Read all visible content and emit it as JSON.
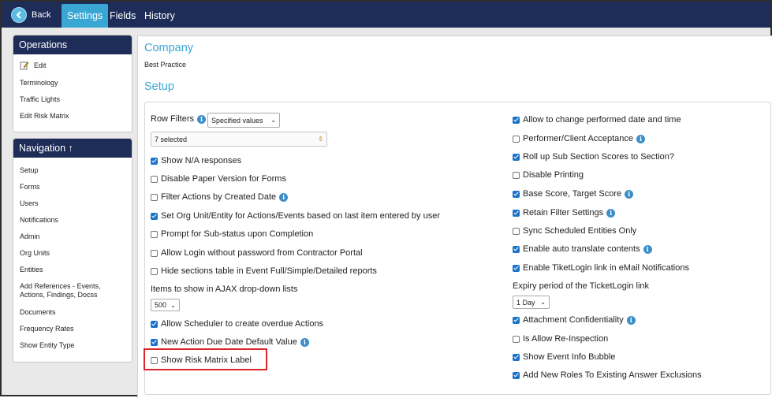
{
  "topbar": {
    "back_label": "Back",
    "tabs": [
      {
        "label": "Settings",
        "active": true
      },
      {
        "label": "Fields",
        "active": false
      },
      {
        "label": "History",
        "active": false
      }
    ]
  },
  "sidebar": {
    "operations": {
      "title": "Operations",
      "items": [
        "Edit",
        "Terminology",
        "Traffic Lights",
        "Edit Risk Matrix"
      ]
    },
    "navigation": {
      "title": "Navigation ↑",
      "items": [
        "Setup",
        "Forms",
        "Users",
        "Notifications",
        "Admin",
        "Org Units",
        "Entities",
        "Add References - Events, Actions, Findings, Docss",
        "Documents",
        "Frequency Rates",
        "Show Entity Type"
      ]
    }
  },
  "main": {
    "company_title": "Company",
    "company_value": "Best Practice",
    "setup_title": "Setup",
    "row_filters_label": "Row Filters",
    "row_filters_select": "Specified values",
    "row_filters_multi": "7 selected",
    "items_ajax_label": "Items to show in AJAX drop-down lists",
    "items_ajax_value": "500",
    "expiry_label": "Expiry period of the TicketLogin link",
    "expiry_value": "1 Day",
    "left_options": [
      {
        "label": "Show N/A responses",
        "checked": true,
        "info": false
      },
      {
        "label": "Disable Paper Version for Forms",
        "checked": false,
        "info": false
      },
      {
        "label": "Filter Actions by Created Date",
        "checked": false,
        "info": true
      },
      {
        "label": "Set Org Unit/Entity for Actions/Events based on last item entered by user",
        "checked": true,
        "info": false
      },
      {
        "label": "Prompt for Sub-status upon Completion",
        "checked": false,
        "info": false
      },
      {
        "label": "Allow Login without password from Contractor Portal",
        "checked": false,
        "info": false
      },
      {
        "label": "Hide sections table in Event Full/Simple/Detailed  reports",
        "checked": false,
        "info": false
      }
    ],
    "left_options_bottom": [
      {
        "label": "Allow Scheduler to create overdue Actions",
        "checked": true,
        "info": false
      },
      {
        "label": "New Action Due Date Default Value",
        "checked": true,
        "info": true
      },
      {
        "label": "Show Risk Matrix Label",
        "checked": false,
        "info": false
      }
    ],
    "right_options": [
      {
        "label": "Allow to change performed date and time",
        "checked": true,
        "info": false
      },
      {
        "label": "Performer/Client Acceptance",
        "checked": false,
        "info": true
      },
      {
        "label": "Roll up Sub Section Scores to Section?",
        "checked": true,
        "info": false
      },
      {
        "label": "Disable Printing",
        "checked": false,
        "info": false
      },
      {
        "label": "Base Score, Target Score",
        "checked": true,
        "info": true
      },
      {
        "label": "Retain Filter Settings",
        "checked": true,
        "info": true
      },
      {
        "label": "Sync Scheduled Entities Only",
        "checked": false,
        "info": false
      },
      {
        "label": "Enable auto translate contents",
        "checked": true,
        "info": true
      },
      {
        "label": "Enable TiketLogin link in eMail Notifications",
        "checked": true,
        "info": false
      }
    ],
    "right_options_bottom": [
      {
        "label": "Attachment Confidentiality",
        "checked": true,
        "info": true
      },
      {
        "label": "Is Allow Re-Inspection",
        "checked": false,
        "info": false
      },
      {
        "label": "Show Event Info Bubble",
        "checked": true,
        "info": false
      },
      {
        "label": "Add New Roles To Existing Answer Exclusions",
        "checked": true,
        "info": false
      }
    ]
  },
  "colors": {
    "topbar": "#1e2d58",
    "active_tab": "#39a6d4",
    "accent_title": "#39a6d4",
    "checkbox_checked": "#1a73c8",
    "highlight_border": "#d9252a"
  }
}
